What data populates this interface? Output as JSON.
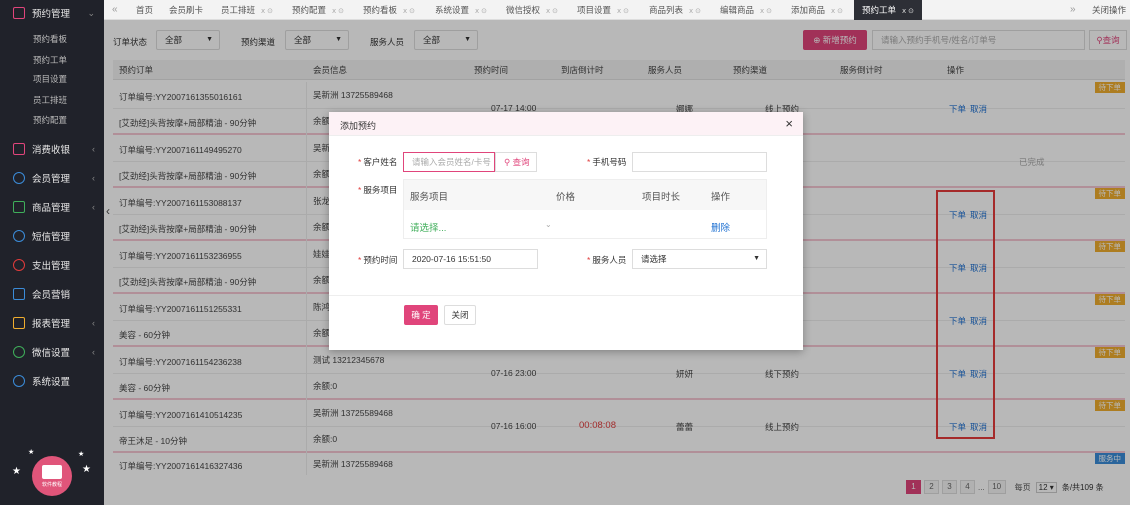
{
  "sidebar": {
    "menus": [
      {
        "label": "预约管理",
        "icon": "calendar-icon",
        "color": "#e0457b"
      },
      {
        "label": "消费收银",
        "icon": "cashier-icon",
        "color": "#e0457b"
      },
      {
        "label": "会员管理",
        "icon": "users-icon",
        "color": "#3b8cd9"
      },
      {
        "label": "商品管理",
        "icon": "goods-icon",
        "color": "#3fae5a"
      },
      {
        "label": "短信管理",
        "icon": "sms-icon",
        "color": "#3b8cd9"
      },
      {
        "label": "支出管理",
        "icon": "expense-icon",
        "color": "#e03b3b"
      },
      {
        "label": "会员营销",
        "icon": "gift-icon",
        "color": "#3b8cd9"
      },
      {
        "label": "报表管理",
        "icon": "report-icon",
        "color": "#f0ad2e"
      },
      {
        "label": "微信设置",
        "icon": "wechat-icon",
        "color": "#3fae5a"
      },
      {
        "label": "系统设置",
        "icon": "settings-icon",
        "color": "#3b8cd9"
      }
    ],
    "sub_items": [
      "预约看板",
      "预约工单",
      "项目设置",
      "员工排班",
      "预约配置"
    ],
    "logo_text": "软件教程"
  },
  "tabs": [
    "首页",
    "会员刷卡",
    "员工排班",
    "预约配置",
    "预约看板",
    "系统设置",
    "微信授权",
    "项目设置",
    "商品列表",
    "编辑商品",
    "添加商品",
    "预约工单"
  ],
  "tab_close_all": "关闭操作",
  "filter": {
    "status_label": "订单状态",
    "status_value": "全部",
    "channel_label": "预约渠道",
    "channel_value": "全部",
    "staff_label": "服务人员",
    "staff_value": "全部",
    "new_button": "新增预约",
    "search_placeholder": "请输入预约手机号/姓名/订单号",
    "search_button": "查询"
  },
  "table": {
    "headers": [
      "预约订单",
      "会员信息",
      "预约时间",
      "到店倒计时",
      "服务人员",
      "预约渠道",
      "服务倒计时",
      "操作"
    ],
    "rows": [
      {
        "order_no": "订单编号:YY2007161355016161",
        "service": "[艾劲经]头背按摩+局部精油 - 90分钟",
        "member": "吴新洲 13725589468",
        "balance": "余额",
        "time": "07-17 14:00",
        "countdown": "",
        "staff": "娜娜",
        "channel": "线上预约",
        "action_order": "下单",
        "action_cancel": "取消",
        "badge": "待下单"
      },
      {
        "order_no": "订单编号:YY2007161149495270",
        "service": "[艾劲经]头背按摩+局部精油 - 90分钟",
        "member": "吴新",
        "balance": "余额",
        "time": "",
        "countdown": "",
        "staff": "",
        "channel": "",
        "status": "已完成",
        "badge": ""
      },
      {
        "order_no": "订单编号:YY2007161153088137",
        "service": "[艾劲经]头背按摩+局部精油 - 90分钟",
        "member": "张龙",
        "balance": "余额",
        "time": "",
        "countdown": "",
        "staff": "",
        "channel": "",
        "action_order": "下单",
        "action_cancel": "取消",
        "badge": "待下单"
      },
      {
        "order_no": "订单编号:YY2007161153236955",
        "service": "[艾劲经]头背按摩+局部精油 - 90分钟",
        "member": "娃娃",
        "balance": "余额",
        "time": "",
        "countdown": "",
        "staff": "",
        "channel": "",
        "action_order": "下单",
        "action_cancel": "取消",
        "badge": "待下单"
      },
      {
        "order_no": "订单编号:YY2007161151255331",
        "service": "美容 - 60分钟",
        "member": "陈鸿",
        "balance": "余额",
        "time": "",
        "countdown": "",
        "staff": "",
        "channel": "",
        "action_order": "下单",
        "action_cancel": "取消",
        "badge": "待下单"
      },
      {
        "order_no": "订单编号:YY2007161154236238",
        "service": "美容 - 60分钟",
        "member": "测试 13212345678",
        "balance": "余额:0",
        "time": "07-16 23:00",
        "countdown": "",
        "staff": "妍妍",
        "channel": "线下预约",
        "action_order": "下单",
        "action_cancel": "取消",
        "badge": "待下单"
      },
      {
        "order_no": "订单编号:YY2007161410514235",
        "service": "帝王沐足 - 10分钟",
        "member": "吴新洲 13725589468",
        "balance": "余额:0",
        "time": "07-16 16:00",
        "countdown": "00:08:08",
        "staff": "蕾蕾",
        "channel": "线上预约",
        "action_order": "下单",
        "action_cancel": "取消",
        "badge": "待下单"
      },
      {
        "order_no": "订单编号:YY2007161416327436",
        "service": "",
        "member": "吴新洲 13725589468",
        "balance": "",
        "time": "",
        "countdown": "",
        "staff": "",
        "channel": "",
        "badge": "服务中"
      }
    ]
  },
  "modal": {
    "title": "添加预约",
    "customer_label": "客户姓名",
    "customer_placeholder": "请输入会员姓名/卡号",
    "customer_search": "查询",
    "phone_label": "手机号码",
    "service_label": "服务项目",
    "service_headers": [
      "服务项目",
      "价格",
      "项目时长",
      "操作"
    ],
    "service_select": "请选择...",
    "service_delete": "删除",
    "time_label": "预约时间",
    "time_value": "2020-07-16 15:51:50",
    "staff_label": "服务人员",
    "staff_value": "请选择",
    "ok_button": "确 定",
    "close_button": "关闭"
  },
  "pagination": {
    "pages": [
      "1",
      "2",
      "3",
      "4",
      "...",
      "10"
    ],
    "per_page_prefix": "每页",
    "per_page": "12",
    "summary": "条/共109 条"
  },
  "colors": {
    "accent": "#e0457b",
    "sidebar": "#20222a",
    "link": "#1c6fd1",
    "badge": "#f0ad2e",
    "highlight": "#e53b3b"
  }
}
